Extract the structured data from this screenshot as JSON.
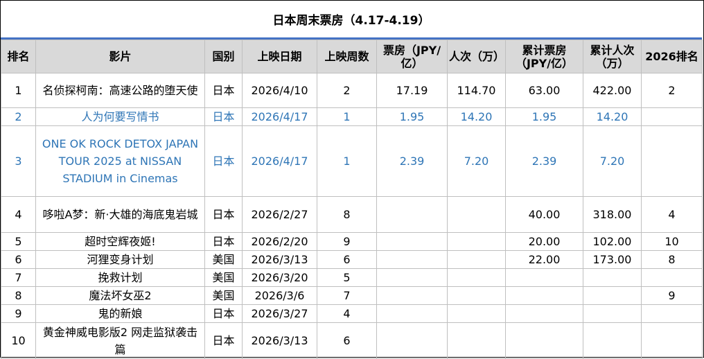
{
  "title": "日本周末票房（4.17-4.19）",
  "header": {
    "rank": "排名",
    "film": "影片",
    "country": "国别",
    "release_date": "上映日期",
    "weeks": "上映周数",
    "gross": "票房（JPY/亿）",
    "admissions": "人次（万）",
    "total_gross": "累计票房（JPY/亿）",
    "total_admissions": "累计人次（万）",
    "rank_2026": "2026排名"
  },
  "rows": [
    {
      "rank": "1",
      "film": "名侦探柯南：高速公路的堕天使",
      "country": "日本",
      "release_date": "2026/4/10",
      "weeks": "2",
      "gross": "17.19",
      "admissions": "114.70",
      "total_gross": "63.00",
      "total_admissions": "422.00",
      "rank_2026": "2",
      "highlight": false
    },
    {
      "rank": "2",
      "film": "人为何要写情书",
      "country": "日本",
      "release_date": "2026/4/17",
      "weeks": "1",
      "gross": "1.95",
      "admissions": "14.20",
      "total_gross": "1.95",
      "total_admissions": "14.20",
      "rank_2026": "",
      "highlight": true
    },
    {
      "rank": "3",
      "film": "ONE OK ROCK DETOX JAPAN TOUR 2025 at NISSAN STADIUM in Cinemas",
      "country": "日本",
      "release_date": "2026/4/17",
      "weeks": "1",
      "gross": "2.39",
      "admissions": "7.20",
      "total_gross": "2.39",
      "total_admissions": "7.20",
      "rank_2026": "",
      "highlight": true
    },
    {
      "rank": "4",
      "film": "哆啦A梦：新·大雄的海底鬼岩城",
      "country": "日本",
      "release_date": "2026/2/27",
      "weeks": "8",
      "gross": "",
      "admissions": "",
      "total_gross": "40.00",
      "total_admissions": "318.00",
      "rank_2026": "4",
      "highlight": false
    },
    {
      "rank": "5",
      "film": "超时空辉夜姬!",
      "country": "日本",
      "release_date": "2026/2/20",
      "weeks": "9",
      "gross": "",
      "admissions": "",
      "total_gross": "20.00",
      "total_admissions": "102.00",
      "rank_2026": "10",
      "highlight": false
    },
    {
      "rank": "6",
      "film": "河狸变身计划",
      "country": "美国",
      "release_date": "2026/3/13",
      "weeks": "6",
      "gross": "",
      "admissions": "",
      "total_gross": "22.00",
      "total_admissions": "173.00",
      "rank_2026": "8",
      "highlight": false
    },
    {
      "rank": "7",
      "film": "挽救计划",
      "country": "美国",
      "release_date": "2026/3/20",
      "weeks": "5",
      "gross": "",
      "admissions": "",
      "total_gross": "",
      "total_admissions": "",
      "rank_2026": "",
      "highlight": false
    },
    {
      "rank": "8",
      "film": "魔法坏女巫2",
      "country": "美国",
      "release_date": "2026/3/6",
      "weeks": "7",
      "gross": "",
      "admissions": "",
      "total_gross": "",
      "total_admissions": "",
      "rank_2026": "9",
      "highlight": false
    },
    {
      "rank": "9",
      "film": "鬼的新娘",
      "country": "日本",
      "release_date": "2026/3/27",
      "weeks": "4",
      "gross": "",
      "admissions": "",
      "total_gross": "",
      "total_admissions": "",
      "rank_2026": "",
      "highlight": false
    },
    {
      "rank": "10",
      "film": "黄金神威电影版2 网走监狱袭击篇",
      "country": "日本",
      "release_date": "2026/3/13",
      "weeks": "6",
      "gross": "",
      "admissions": "",
      "total_gross": "",
      "total_admissions": "",
      "rank_2026": "",
      "highlight": false
    }
  ],
  "colors": {
    "accent_rule": "#4472c4",
    "highlight_text": "#2e75b6",
    "header_bg": "#d9d9d9",
    "grid": "#bfbfbf"
  }
}
